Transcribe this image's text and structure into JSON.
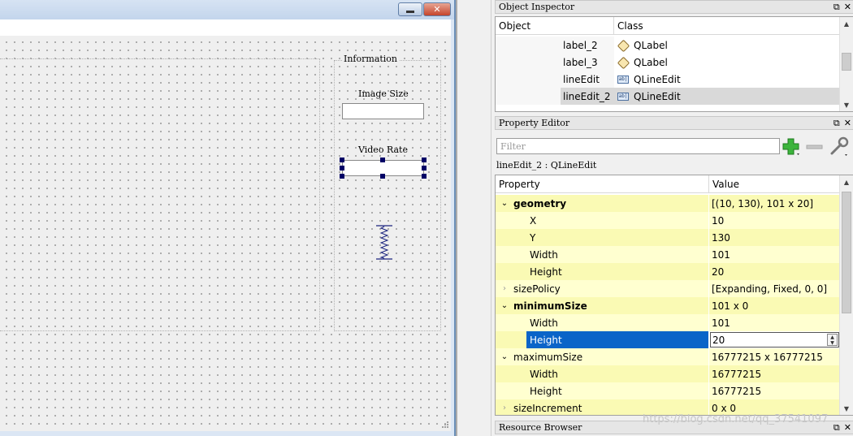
{
  "form": {
    "group_title": "Information",
    "image_size_label": "Image Size",
    "video_rate_label": "Video Rate"
  },
  "object_inspector": {
    "title": "Object Inspector",
    "headers": [
      "Object",
      "Class"
    ],
    "rows": [
      {
        "object": "label_2",
        "class": "QLabel",
        "icon": "label-icon"
      },
      {
        "object": "label_3",
        "class": "QLabel",
        "icon": "label-icon"
      },
      {
        "object": "lineEdit",
        "class": "QLineEdit",
        "icon": "lineedit-icon"
      },
      {
        "object": "lineEdit_2",
        "class": "QLineEdit",
        "icon": "lineedit-icon"
      }
    ]
  },
  "property_editor": {
    "title": "Property Editor",
    "filter_placeholder": "Filter",
    "context": "lineEdit_2 : QLineEdit",
    "headers": [
      "Property",
      "Value"
    ],
    "rows": [
      {
        "name": "geometry",
        "value": "[(10, 130), 101 x 20]"
      },
      {
        "name": "X",
        "value": "10"
      },
      {
        "name": "Y",
        "value": "130"
      },
      {
        "name": "Width",
        "value": "101"
      },
      {
        "name": "Height",
        "value": "20"
      },
      {
        "name": "sizePolicy",
        "value": "[Expanding, Fixed, 0, 0]"
      },
      {
        "name": "minimumSize",
        "value": "101 x 0"
      },
      {
        "name": "Width",
        "value": "101"
      },
      {
        "name": "Height",
        "value": "20"
      },
      {
        "name": "maximumSize",
        "value": "16777215 x 16777215"
      },
      {
        "name": "Width",
        "value": "16777215"
      },
      {
        "name": "Height",
        "value": "16777215"
      },
      {
        "name": "sizeIncrement",
        "value": "0 x 0"
      }
    ]
  },
  "resource_browser": {
    "title": "Resource Browser"
  },
  "dock_buttons": {
    "float": "⧉",
    "close": "✕"
  },
  "watermark": "https://blog.csdn.net/qq_37541097",
  "colors": {
    "highlight": "#0a64c8",
    "selected_row": "#d9d9d9",
    "property_row": "#ffffd0"
  }
}
